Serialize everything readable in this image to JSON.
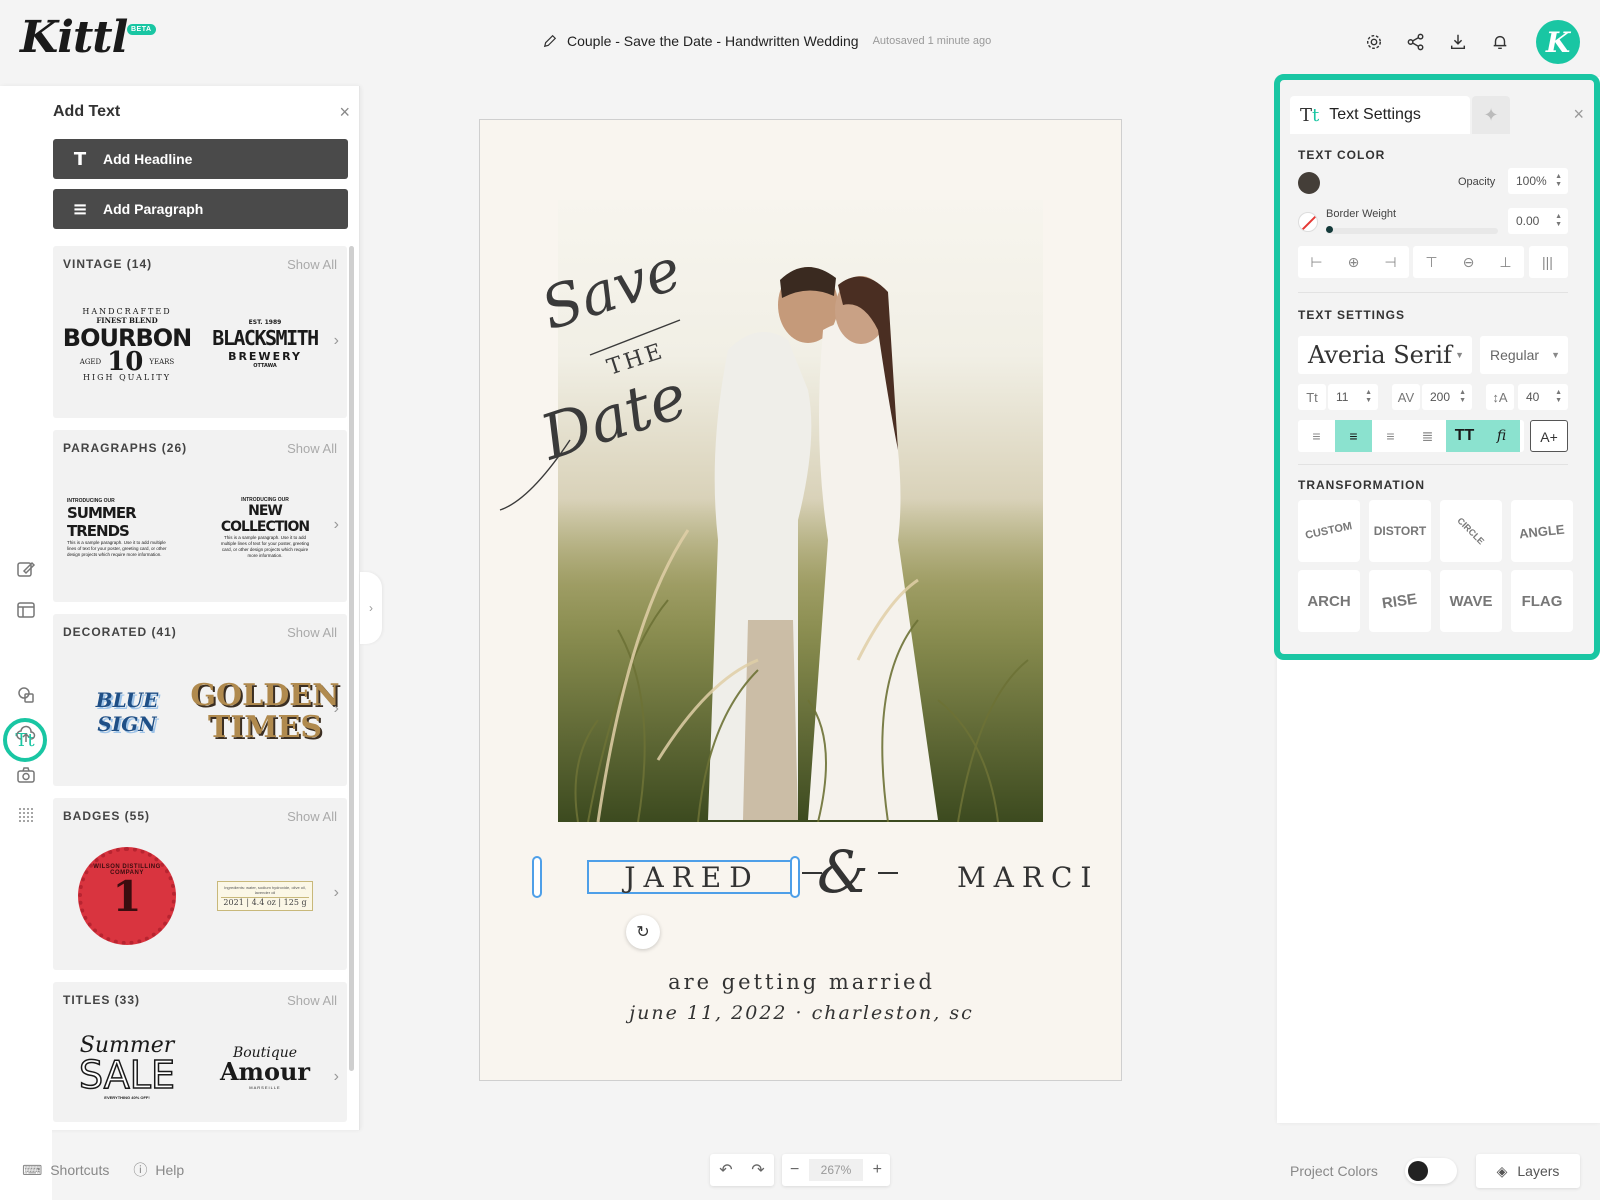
{
  "header": {
    "logo": "Kittl",
    "beta": "BETA",
    "doc_name": "Couple - Save the Date - Handwritten Wedding",
    "autosave": "Autosaved 1 minute ago",
    "avatar_letter": "K",
    "icons": [
      "gear-icon",
      "share-icon",
      "download-icon",
      "bell-icon"
    ]
  },
  "rail": {
    "icons": [
      "edit-icon",
      "template-icon",
      "text-icon",
      "shapes-icon",
      "upload-icon",
      "camera-icon",
      "grid-dots-icon"
    ],
    "active_label": "Tt"
  },
  "add_text": {
    "title": "Add Text",
    "headline_btn": "Add Headline",
    "paragraph_btn": "Add Paragraph",
    "show_all": "Show All",
    "categories": [
      {
        "name": "VINTAGE (14)",
        "samples": [
          [
            "HANDCRAFTED",
            "FINEST BLEND",
            "BOURBON",
            "AGED",
            "10",
            "YEARS",
            "HIGH QUALITY"
          ],
          [
            "EST. 1989",
            "BLACKSMITH",
            "BREWERY",
            "OTTAWA"
          ]
        ]
      },
      {
        "name": "PARAGRAPHS (26)",
        "samples": [
          [
            "INTRODUCING OUR",
            "SUMMER TRENDS",
            "This is a sample paragraph. Use it to add multiple lines of text for your poster, greeting card, or other design projects which require more information."
          ],
          [
            "INTRODUCING OUR",
            "NEW COLLECTION",
            "This is a sample paragraph. Use it to add multiple lines of text for your poster, greeting card, or other design projects which require more information."
          ]
        ]
      },
      {
        "name": "DECORATED (41)",
        "samples": [
          [
            "BLUE SIGN"
          ],
          [
            "GOLDEN",
            "TIMES"
          ]
        ]
      },
      {
        "name": "BADGES (55)",
        "samples": [
          [
            "WILSON DISTILLING COMPANY",
            "1"
          ],
          [
            "Ingredients: water, sodium hydroxide, olive oil, lavender oil",
            "2021 | 4.4 oz | 125 g"
          ]
        ]
      },
      {
        "name": "TITLES (33)",
        "samples": [
          [
            "Summer",
            "SALE",
            "EVERYTHING 40% OFF!"
          ],
          [
            "Boutique",
            "Amour",
            "MARSEILLE"
          ]
        ]
      }
    ]
  },
  "canvas": {
    "script_lines": [
      "Save",
      "THE",
      "Date"
    ],
    "name_left": "JARED",
    "ampersand": "&",
    "name_right": "MARCI",
    "line1": "are getting married",
    "line2": "june 11, 2022 · charleston, sc",
    "background": "#f9f5ef"
  },
  "text_settings": {
    "tab_label": "Text Settings",
    "tab_icon_a": "T",
    "tab_icon_b": "t",
    "text_color_label": "TEXT COLOR",
    "text_color": "#443e38",
    "opacity_label": "Opacity",
    "opacity_value": "100%",
    "border_label": "Border Weight",
    "border_value": "0.00",
    "settings_label": "TEXT SETTINGS",
    "font": "Averia Serif",
    "weight": "Regular",
    "size": "11",
    "spacing": "200",
    "line_height": "40",
    "transform_label": "TRANSFORMATION",
    "transforms": [
      "CUSTOM",
      "DISTORT",
      "CIRCLE",
      "ANGLE",
      "ARCH",
      "RISE",
      "WAVE",
      "FLAG"
    ],
    "accent": "#19c6a3"
  },
  "bottom": {
    "shortcuts": "Shortcuts",
    "help": "Help",
    "zoom": "267%",
    "project_colors": "Project Colors",
    "layers": "Layers"
  }
}
